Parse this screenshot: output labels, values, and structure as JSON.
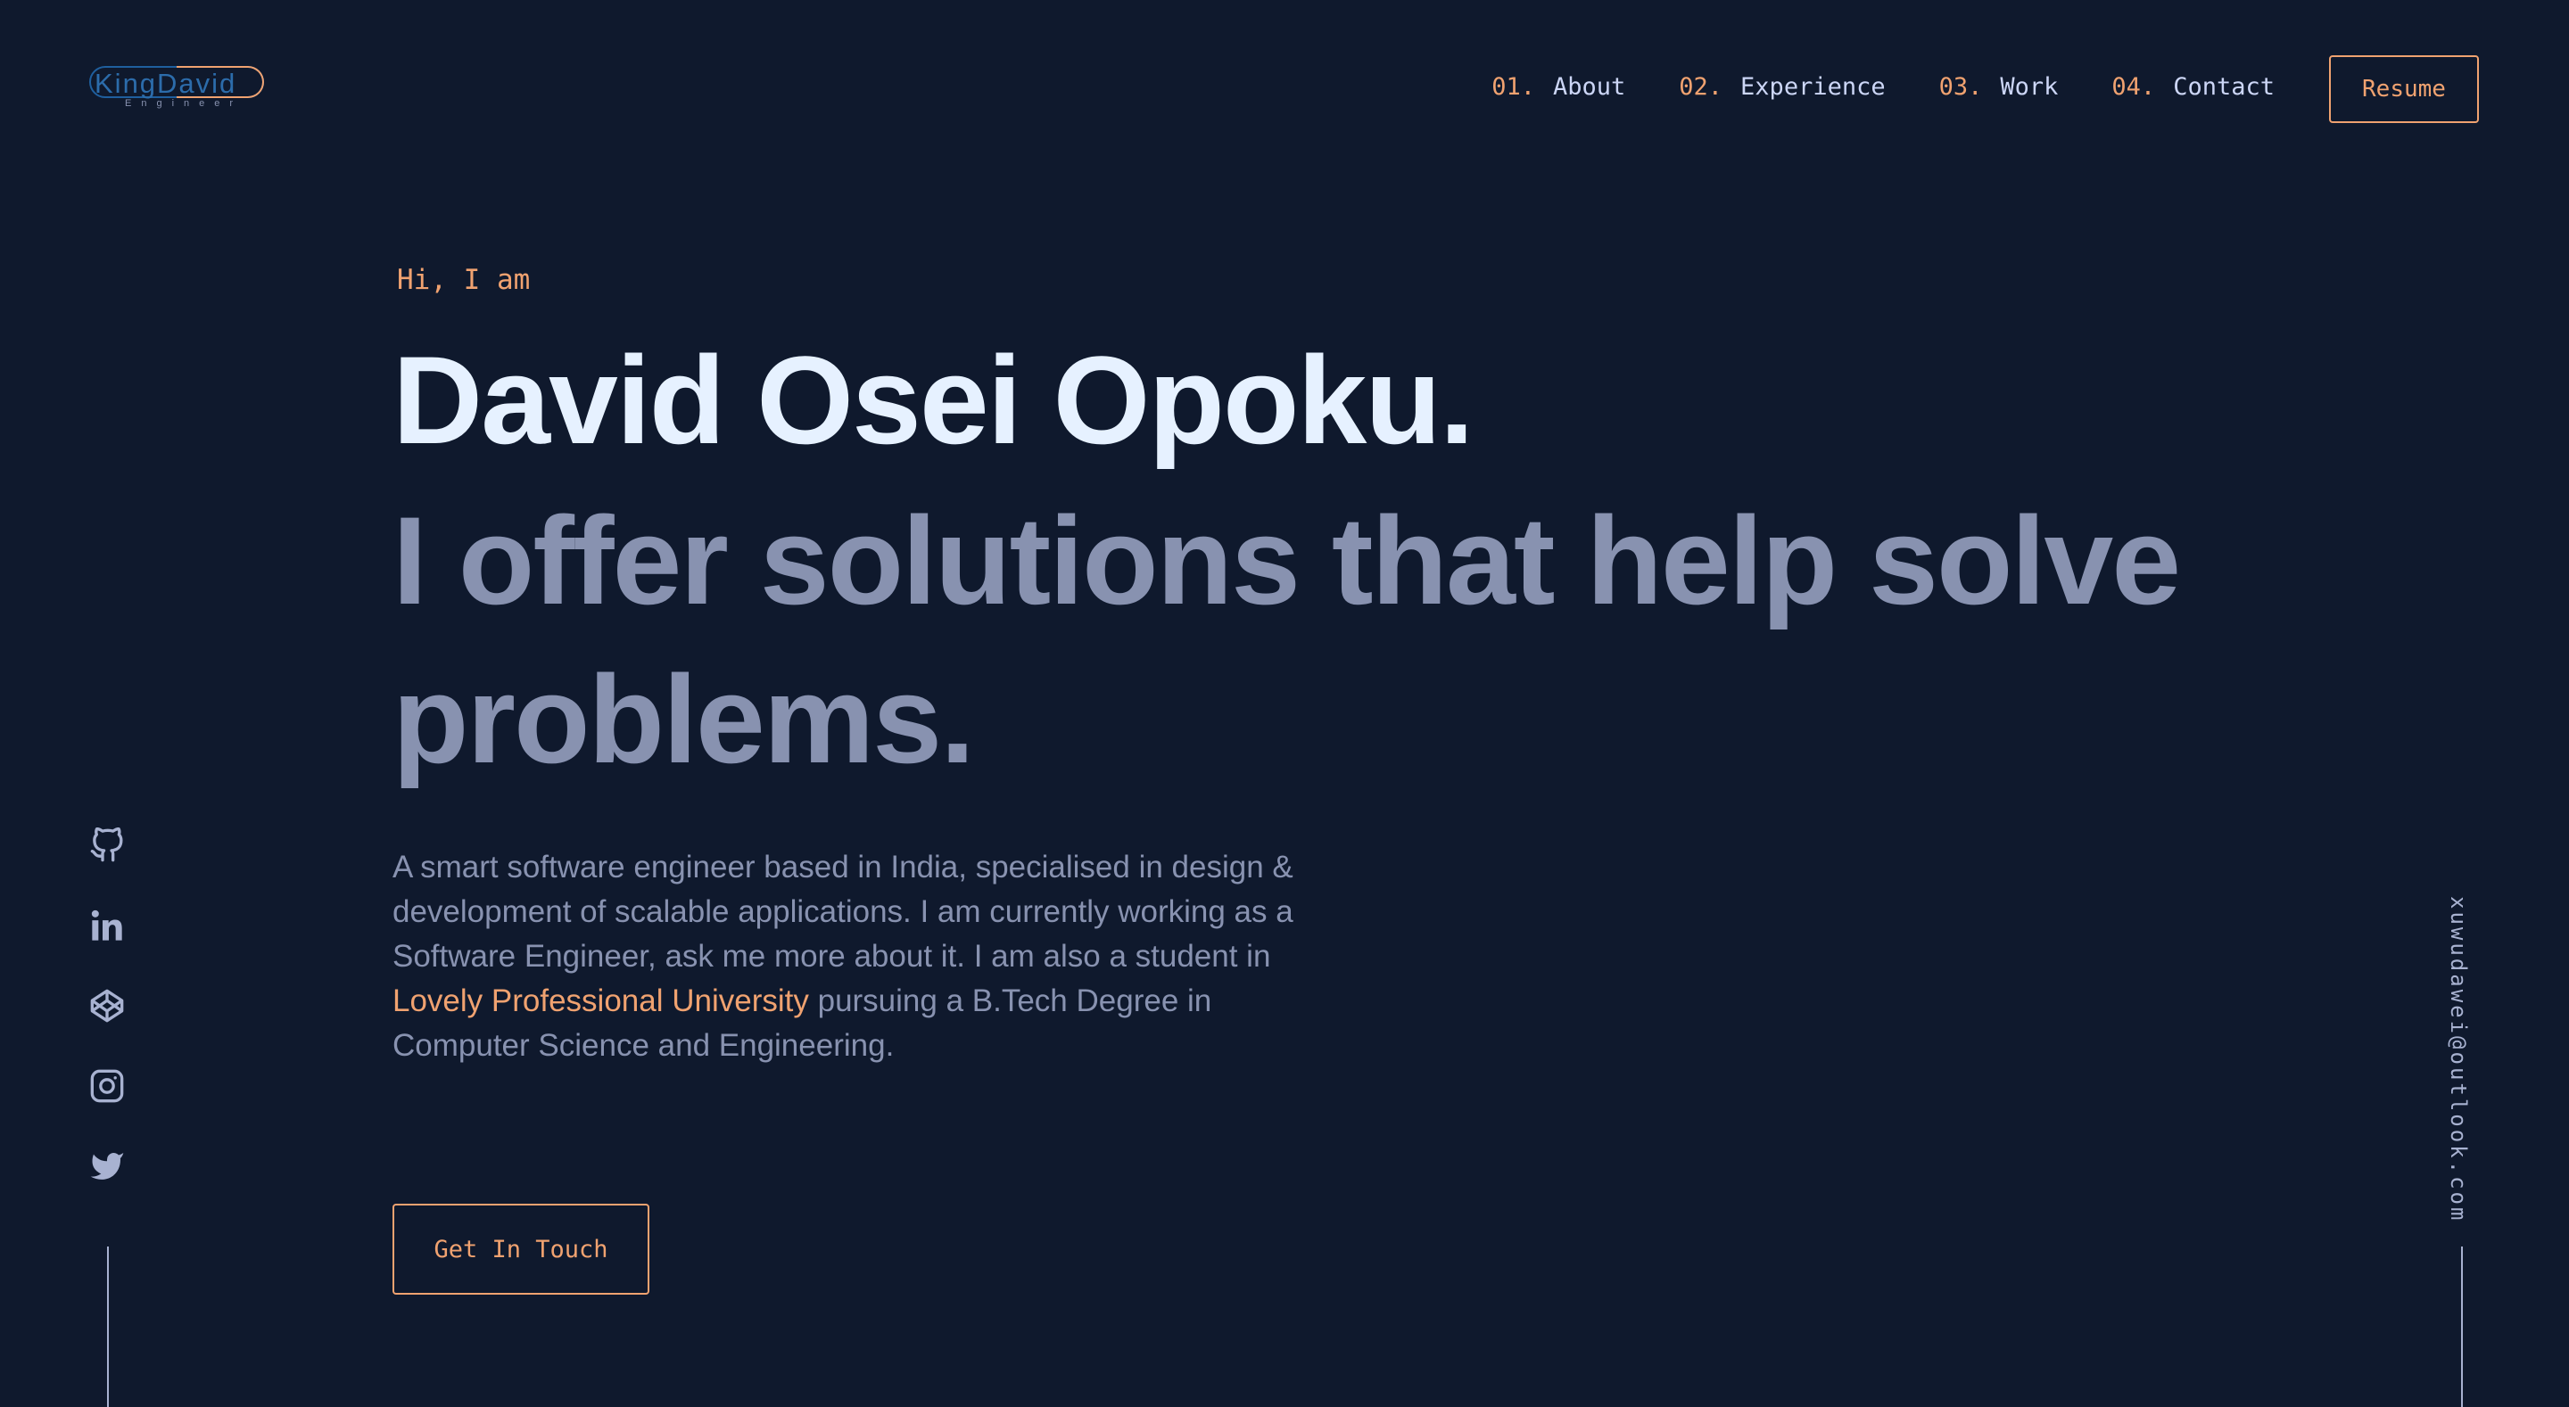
{
  "brand": {
    "logo_text": "KingDavid",
    "logo_sub": "Engineer"
  },
  "nav": {
    "items": [
      {
        "num": "01.",
        "label": "About"
      },
      {
        "num": "02.",
        "label": "Experience"
      },
      {
        "num": "03.",
        "label": "Work"
      },
      {
        "num": "04.",
        "label": "Contact"
      }
    ],
    "resume_label": "Resume"
  },
  "hero": {
    "greeting": "Hi, I am",
    "name": "David Osei Opoku.",
    "tagline": "I offer solutions that help solve problems.",
    "desc_before": "A smart software engineer based in India, specialised in design & development of scalable applications. I am currently working as a Software Engineer, ask me more about it. I am also a student in ",
    "desc_link": "Lovely Professional University",
    "desc_after": " pursuing a B.Tech Degree in Computer Science and Engineering.",
    "cta_label": "Get In Touch"
  },
  "social": {
    "icons": [
      "github-icon",
      "linkedin-icon",
      "codepen-icon",
      "instagram-icon",
      "twitter-icon"
    ]
  },
  "email": "xuwudawei@outlook.com",
  "colors": {
    "background": "#0f192d",
    "accent": "#f0a270",
    "heading": "#e6f1ff",
    "text": "#8892b0"
  }
}
